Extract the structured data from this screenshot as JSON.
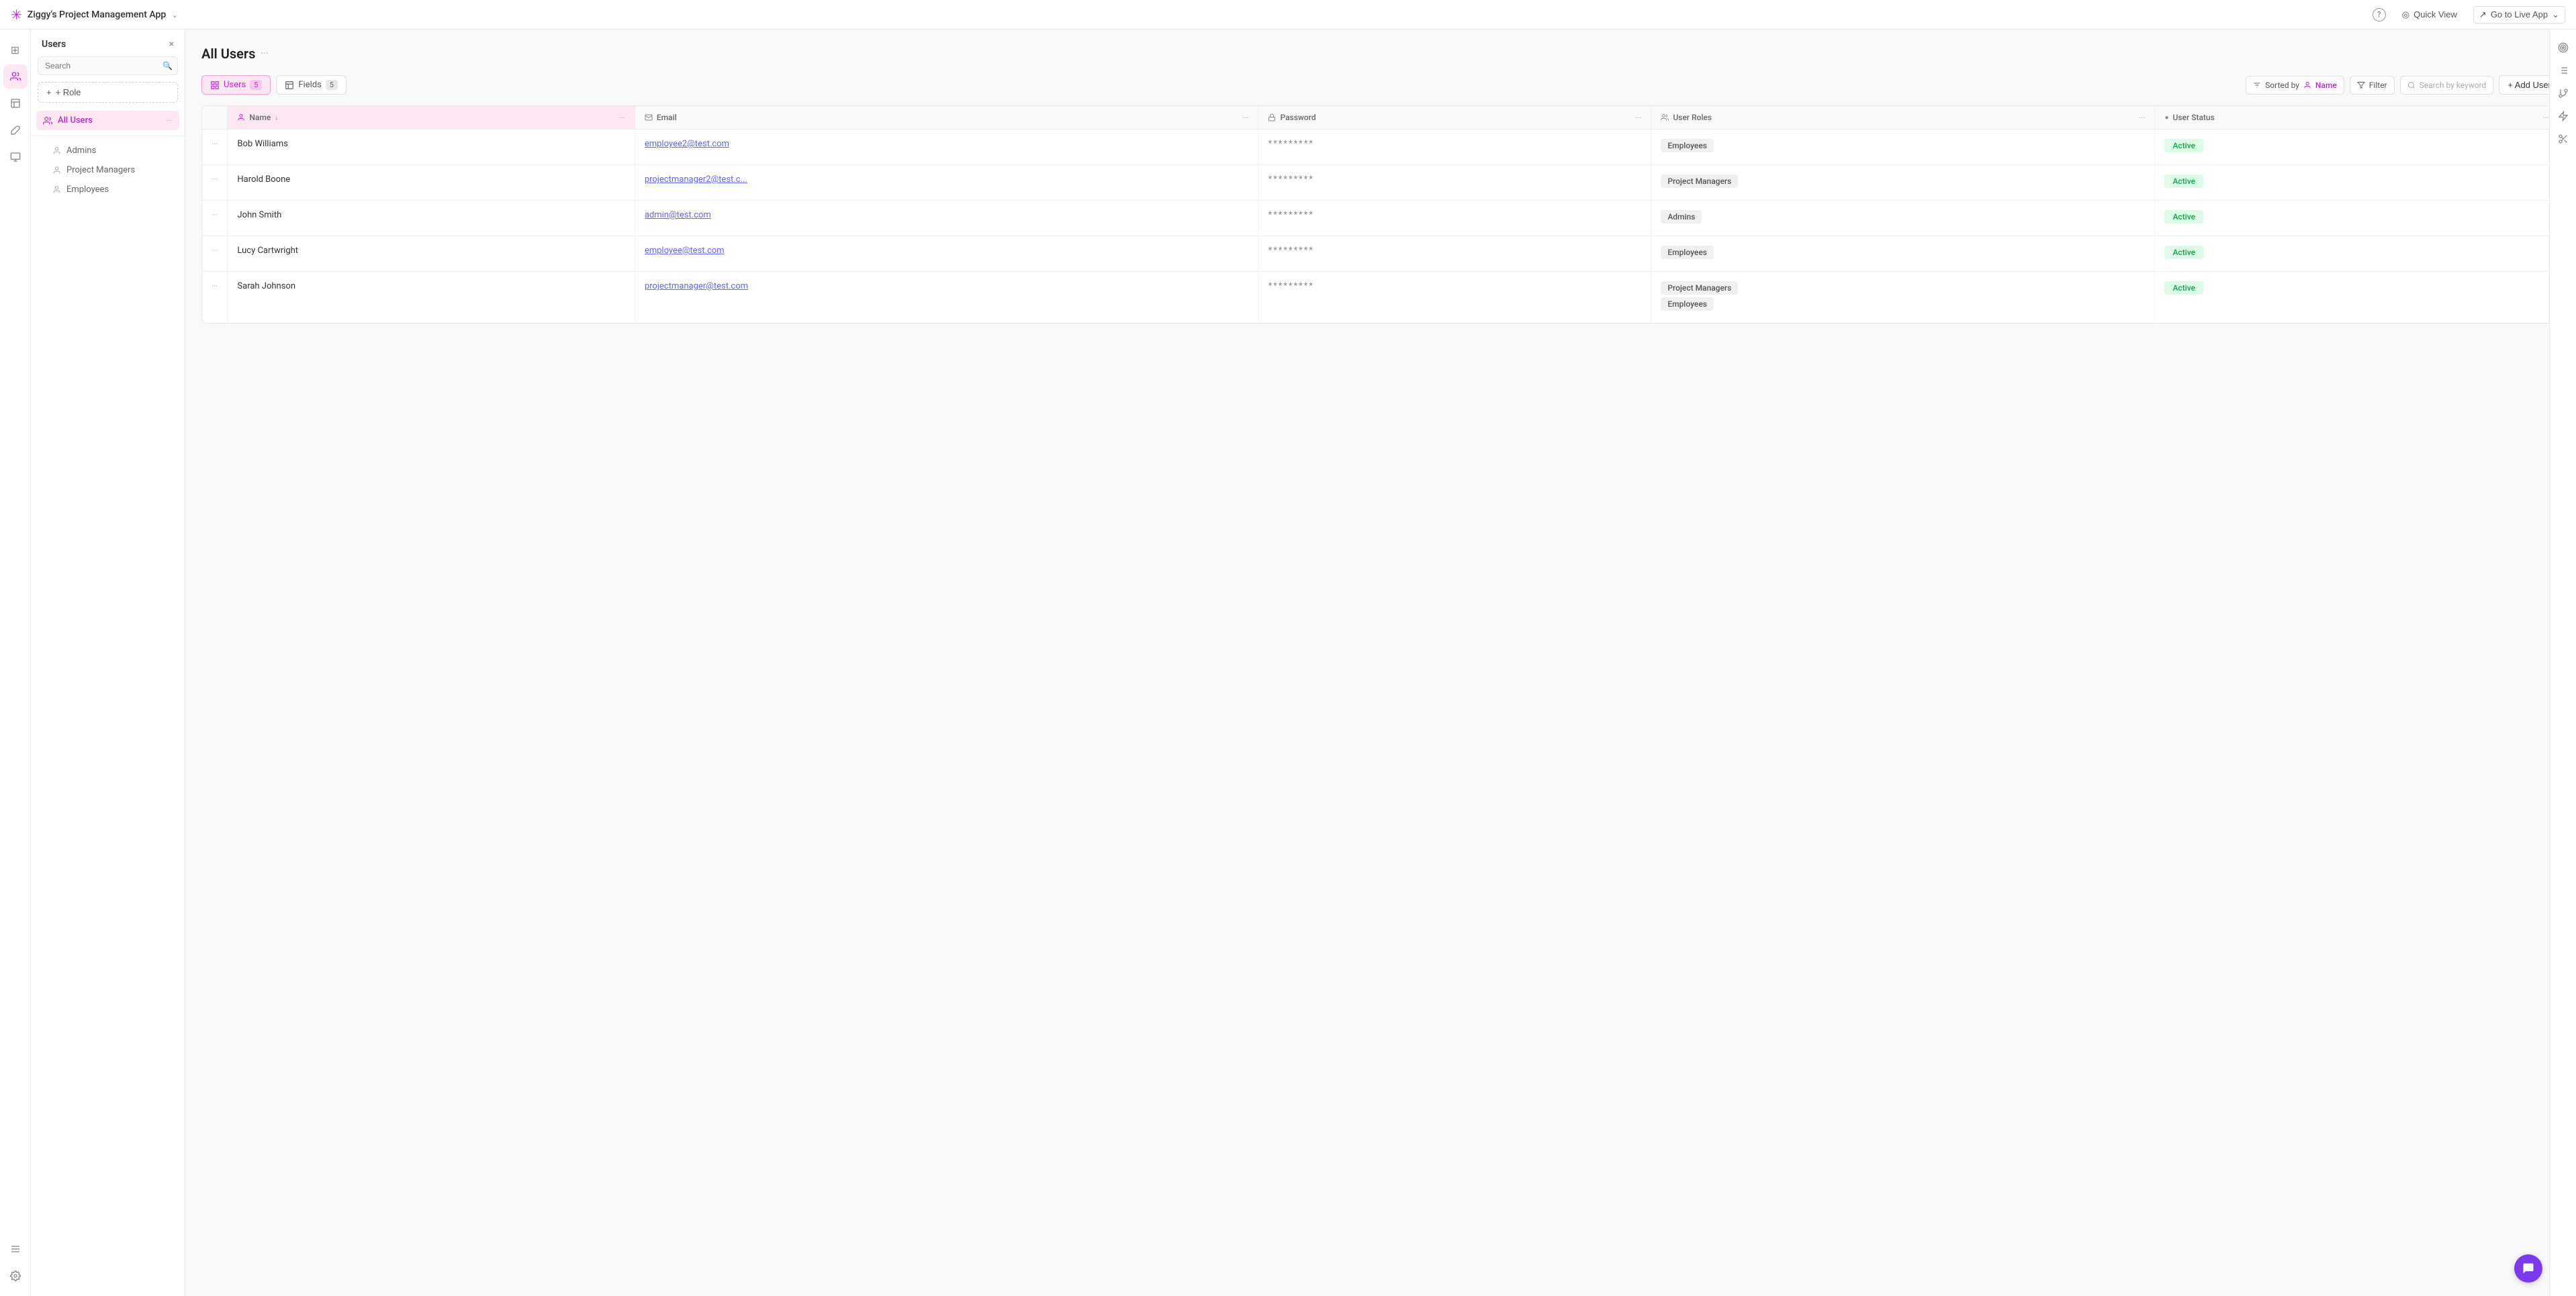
{
  "app": {
    "title": "Ziggy's Project Management App",
    "logo": "✳",
    "chevron": "⌄"
  },
  "topbar": {
    "help_title": "?",
    "quick_view_label": "Quick View",
    "live_app_label": "Go to Live App",
    "expand_icon": "⌄"
  },
  "icon_sidebar": {
    "items": [
      {
        "name": "grid-icon",
        "icon": "⊞",
        "active": false
      },
      {
        "name": "users-icon",
        "icon": "👤",
        "active": true
      },
      {
        "name": "pages-icon",
        "icon": "📄",
        "active": false
      },
      {
        "name": "brush-icon",
        "icon": "✏",
        "active": false
      },
      {
        "name": "layout-icon",
        "icon": "⊟",
        "active": false
      },
      {
        "name": "menu-icon",
        "icon": "☰",
        "active": false
      },
      {
        "name": "settings-icon",
        "icon": "⚙",
        "active": false
      }
    ]
  },
  "users_sidebar": {
    "title": "Users",
    "close_icon": "×",
    "search_placeholder": "Search",
    "add_role_label": "+ Role",
    "nav_items": [
      {
        "name": "all-users",
        "label": "All Users",
        "active": true,
        "more": "···"
      }
    ],
    "sub_items": [
      {
        "name": "admins",
        "label": "Admins"
      },
      {
        "name": "project-managers",
        "label": "Project Managers"
      },
      {
        "name": "employees",
        "label": "Employees"
      }
    ]
  },
  "page": {
    "title": "All Users",
    "more": "···"
  },
  "toolbar": {
    "tabs": [
      {
        "name": "users-tab",
        "label": "Users",
        "count": "5",
        "active": true,
        "icon": "≡"
      },
      {
        "name": "fields-tab",
        "label": "Fields",
        "count": "5",
        "active": false,
        "icon": "⊞"
      }
    ],
    "sort_label": "Sorted by",
    "sort_field": "Name",
    "filter_label": "Filter",
    "search_placeholder": "Search by keyword",
    "add_user_label": "+ Add User"
  },
  "table": {
    "columns": [
      {
        "name": "row-options",
        "label": ""
      },
      {
        "name": "col-name",
        "label": "Name",
        "icon": "👤",
        "sortable": true
      },
      {
        "name": "col-email",
        "label": "Email",
        "icon": "✉"
      },
      {
        "name": "col-password",
        "label": "Password",
        "icon": "🔒"
      },
      {
        "name": "col-user-roles",
        "label": "User Roles",
        "icon": "👥"
      },
      {
        "name": "col-user-status",
        "label": "User Status",
        "icon": "●"
      }
    ],
    "rows": [
      {
        "options": "···",
        "name": "Bob Williams",
        "email": "employee2@test.com",
        "password": "*********",
        "roles": [
          "Employees"
        ],
        "status": "Active"
      },
      {
        "options": "···",
        "name": "Harold Boone",
        "email": "projectmanager2@test.c...",
        "password": "*********",
        "roles": [
          "Project Managers"
        ],
        "status": "Active"
      },
      {
        "options": "···",
        "name": "John Smith",
        "email": "admin@test.com",
        "password": "*********",
        "roles": [
          "Admins"
        ],
        "status": "Active"
      },
      {
        "options": "···",
        "name": "Lucy Cartwright",
        "email": "employee@test.com",
        "password": "*********",
        "roles": [
          "Employees"
        ],
        "status": "Active"
      },
      {
        "options": "···",
        "name": "Sarah Johnson",
        "email": "projectmanager@test.com",
        "password": "*********",
        "roles": [
          "Project Managers",
          "Employees"
        ],
        "status": "Active"
      }
    ]
  },
  "right_panel": {
    "icons": [
      {
        "name": "target-icon",
        "icon": "⊕"
      },
      {
        "name": "list-lines-icon",
        "icon": "☰"
      },
      {
        "name": "branch-icon",
        "icon": "⎇"
      },
      {
        "name": "lightning-icon",
        "icon": "⚡"
      },
      {
        "name": "scissors-icon",
        "icon": "✂"
      }
    ]
  },
  "chat": {
    "icon": "💬"
  }
}
